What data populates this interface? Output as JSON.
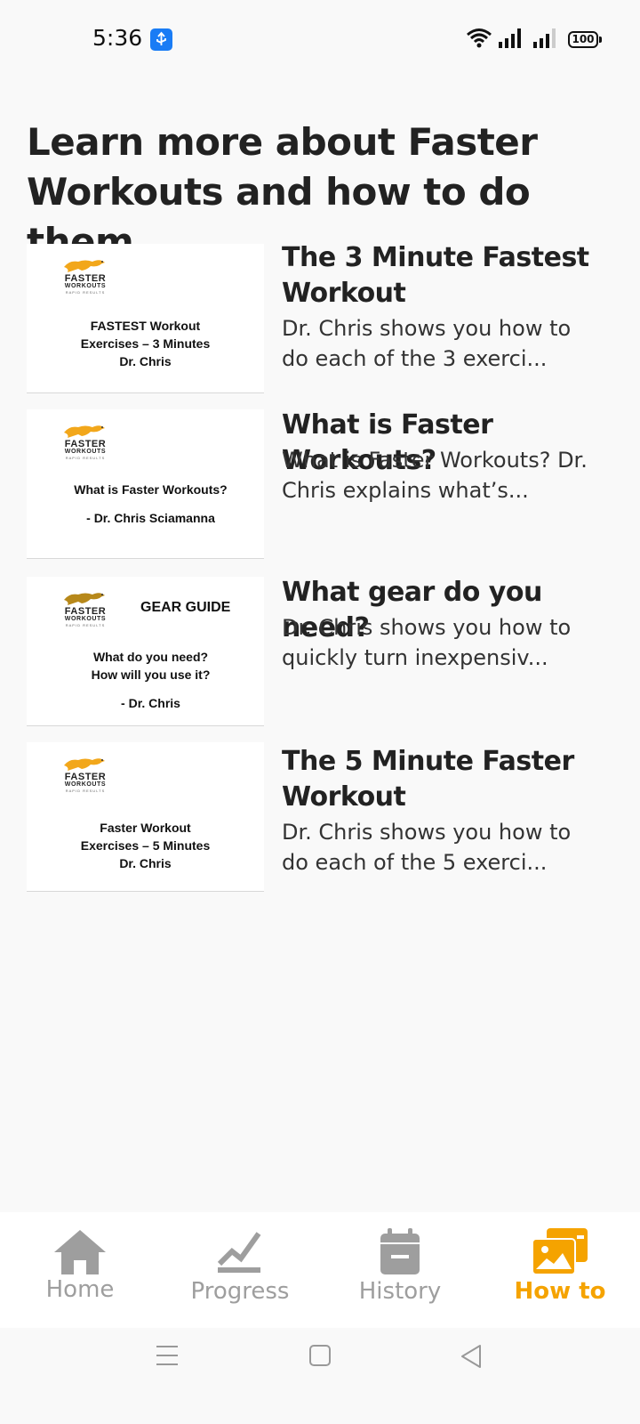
{
  "status_bar": {
    "time": "5:36",
    "battery": "100",
    "icons": [
      "usb-icon",
      "wifi-icon",
      "signal-icon",
      "signal-icon",
      "battery-icon"
    ],
    "usb_color": "#1a7cf5"
  },
  "page": {
    "title": "Learn more about Faster Workouts and how to do them"
  },
  "videos": [
    {
      "title": "The 3 Minute Fastest Workout",
      "description": "Dr. Chris shows you how to do each of the 3 exerci...",
      "thumb": {
        "logo_word": "FASTER",
        "logo_word2": "WORKOUTS",
        "logo_tag": "RAPID RESULTS",
        "line1": "FASTEST Workout",
        "line2": "Exercises – 3 Minutes",
        "line3": "Dr. Chris"
      }
    },
    {
      "title": "What is Faster Workouts?",
      "description": "What is Faster Workouts? Dr. Chris explains what’s...",
      "thumb": {
        "logo_word": "FASTER",
        "logo_word2": "WORKOUTS",
        "logo_tag": "RAPID RESULTS",
        "line1": "What is Faster Workouts?",
        "line2": "- Dr. Chris Sciamanna"
      }
    },
    {
      "title": "What gear do you need?",
      "description": "Dr. Chris shows you how to quickly turn inexpensiv...",
      "thumb": {
        "logo_word": "FASTER",
        "logo_word2": "WORKOUTS",
        "logo_tag": "RAPID RESULTS",
        "heading": "GEAR GUIDE",
        "line1": "What do you need?",
        "line2": "How will you use it?",
        "line3": "- Dr. Chris"
      }
    },
    {
      "title": "The 5 Minute Faster Workout",
      "description": "Dr. Chris shows you how to do each of the 5 exerci...",
      "thumb": {
        "logo_word": "FASTER",
        "logo_word2": "WORKOUTS",
        "logo_tag": "RAPID RESULTS",
        "line1": "Faster Workout",
        "line2": "Exercises – 5 Minutes",
        "line3": "Dr. Chris"
      }
    }
  ],
  "bottom_nav": {
    "items": [
      {
        "label": "Home",
        "icon": "home-icon",
        "active": false
      },
      {
        "label": "Progress",
        "icon": "chart-icon",
        "active": false
      },
      {
        "label": "History",
        "icon": "calendar-icon",
        "active": false
      },
      {
        "label": "How to",
        "icon": "media-icon",
        "active": true
      }
    ],
    "inactive_color": "#9e9e9e",
    "active_color": "#f5a300"
  },
  "system_nav": {
    "icons": [
      "menu-icon",
      "home-square-icon",
      "back-icon"
    ]
  }
}
